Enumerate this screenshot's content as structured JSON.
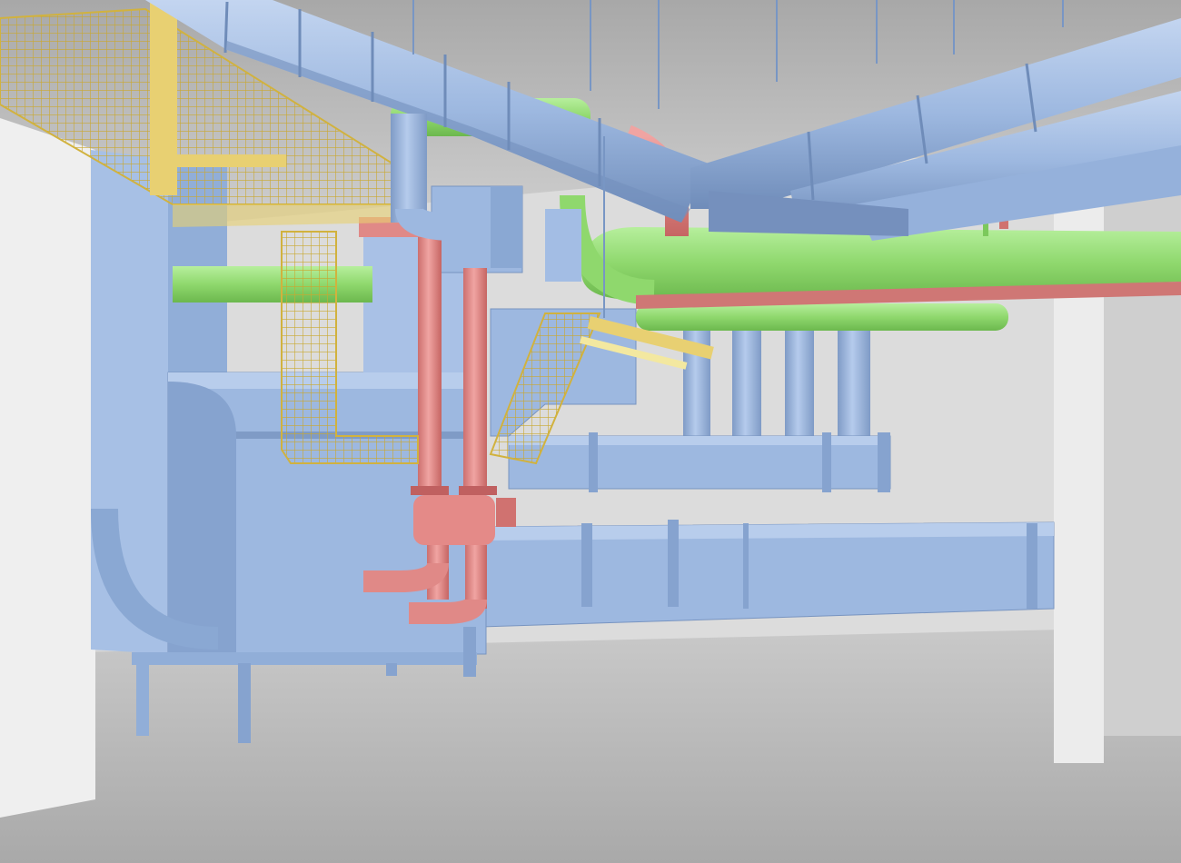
{
  "scene": {
    "palette": {
      "supply_duct": "#9db8e0",
      "supply_duct_shadow": "#7f9bc6",
      "return_pipe": "#98e07a",
      "chilled_pipe": "#e89391",
      "cable_tray": "#e8d072",
      "ceiling": "#bdbdbd",
      "wall": "#e8e8e8",
      "floor": "#b9b9b9"
    }
  }
}
